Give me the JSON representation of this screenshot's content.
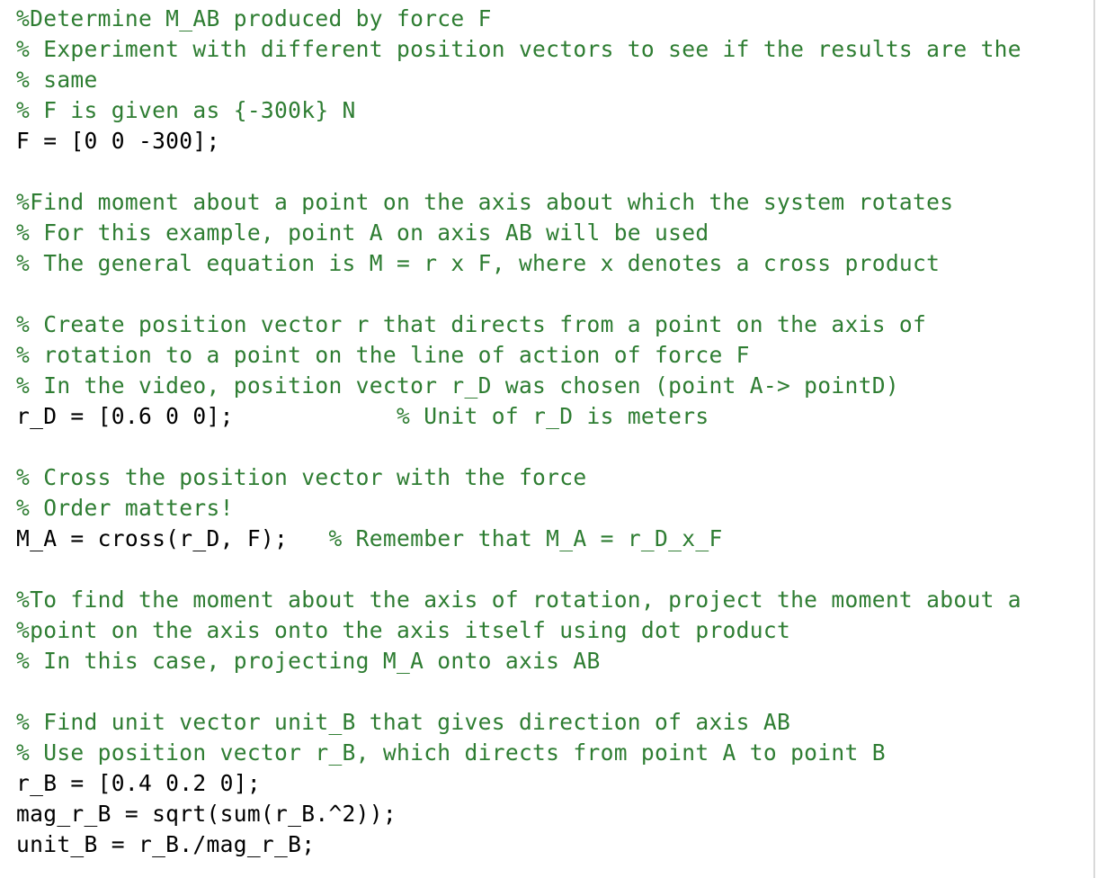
{
  "editor": {
    "lines": [
      [
        {
          "type": "comment",
          "text": "%Determine M_AB produced by force F"
        }
      ],
      [
        {
          "type": "comment",
          "text": "% Experiment with different position vectors to see if the results are the"
        }
      ],
      [
        {
          "type": "comment",
          "text": "% same"
        }
      ],
      [
        {
          "type": "comment",
          "text": "% F is given as {-300k} N"
        }
      ],
      [
        {
          "type": "code",
          "text": "F = [0 0 -300];"
        }
      ],
      [],
      [
        {
          "type": "comment",
          "text": "%Find moment about a point on the axis about which the system rotates"
        }
      ],
      [
        {
          "type": "comment",
          "text": "% For this example, point A on axis AB will be used"
        }
      ],
      [
        {
          "type": "comment",
          "text": "% The general equation is M = r x F, where x denotes a cross product"
        }
      ],
      [],
      [
        {
          "type": "comment",
          "text": "% Create position vector r that directs from a point on the axis of"
        }
      ],
      [
        {
          "type": "comment",
          "text": "% rotation to a point on the line of action of force F"
        }
      ],
      [
        {
          "type": "comment",
          "text": "% In the video, position vector r_D was chosen (point A-> pointD)"
        }
      ],
      [
        {
          "type": "code",
          "text": "r_D = [0.6 0 0];"
        },
        {
          "type": "space",
          "text": "            "
        },
        {
          "type": "comment",
          "text": "% Unit of r_D is meters"
        }
      ],
      [],
      [
        {
          "type": "comment",
          "text": "% Cross the position vector with the force"
        }
      ],
      [
        {
          "type": "comment",
          "text": "% Order matters!"
        }
      ],
      [
        {
          "type": "code",
          "text": "M_A = cross(r_D, F);"
        },
        {
          "type": "space",
          "text": "   "
        },
        {
          "type": "comment",
          "text": "% Remember that M_A = r_D_x_F"
        }
      ],
      [],
      [
        {
          "type": "comment",
          "text": "%To find the moment about the axis of rotation, project the moment about a"
        }
      ],
      [
        {
          "type": "comment",
          "text": "%point on the axis onto the axis itself using dot product"
        }
      ],
      [
        {
          "type": "comment",
          "text": "% In this case, projecting M_A onto axis AB"
        }
      ],
      [],
      [
        {
          "type": "comment",
          "text": "% Find unit vector unit_B that gives direction of axis AB"
        }
      ],
      [
        {
          "type": "comment",
          "text": "% Use position vector r_B, which directs from point A to point B"
        }
      ],
      [
        {
          "type": "code",
          "text": "r_B = [0.4 0.2 0];"
        }
      ],
      [
        {
          "type": "code",
          "text": "mag_r_B = sqrt(sum(r_B.^2));"
        }
      ],
      [
        {
          "type": "code",
          "text": "unit_B = r_B./mag_r_B;"
        }
      ]
    ]
  }
}
